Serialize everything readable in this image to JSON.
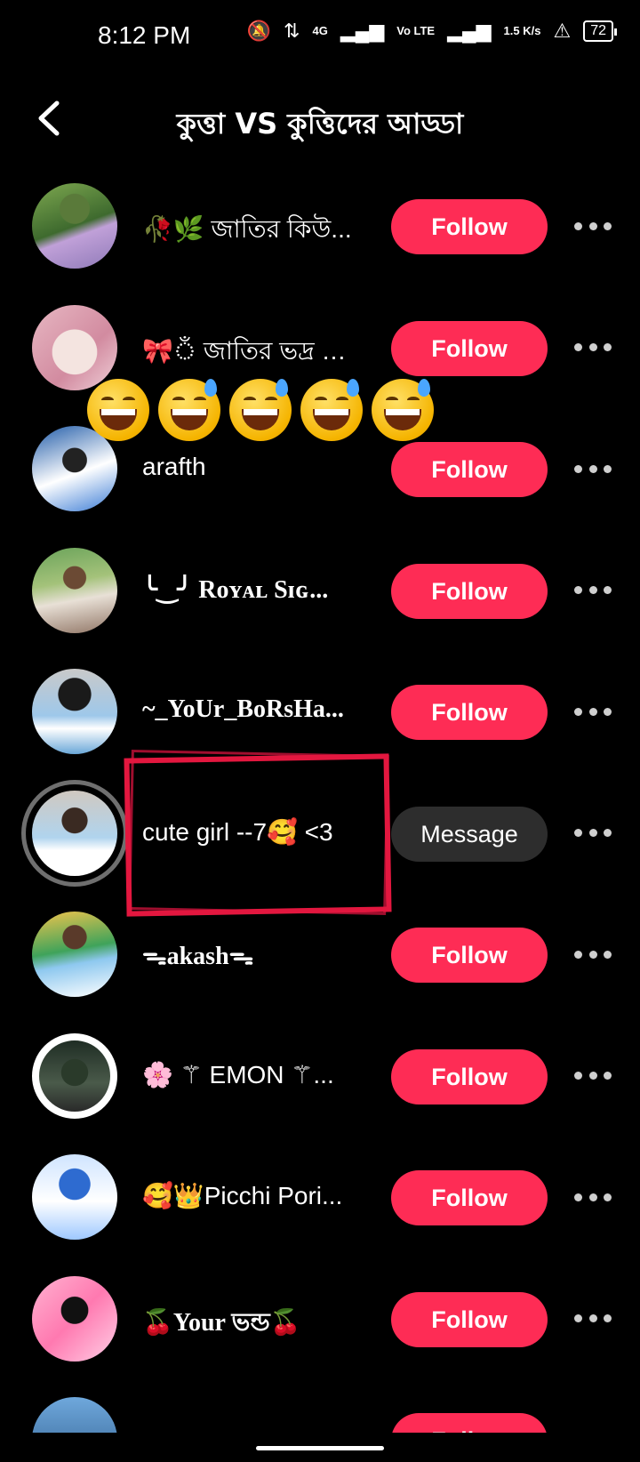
{
  "status_bar": {
    "time": "8:12 PM",
    "network_4g": "4G",
    "volte": "Vo LTE",
    "speed": "1.5 K/s",
    "battery": "72"
  },
  "header": {
    "title": "কুত্তা VS কুত্তিদের আড্ডা"
  },
  "overlay": {
    "emojis": [
      "😅",
      "😅",
      "😅",
      "😅",
      "😅"
    ]
  },
  "rows": [
    {
      "name": "🥀🌿 জাতির কিউ...",
      "action": "Follow"
    },
    {
      "name": "🎀ঁ জাতির ভদ্র ভা...",
      "action": "Follow"
    },
    {
      "name": "arafth",
      "action": "Follow"
    },
    {
      "name": "╰‿╯ Rᴏʏᴀʟ  Sɪɢ...",
      "action": "Follow"
    },
    {
      "name": "~_YoUr_BoRsHa...",
      "action": "Follow"
    },
    {
      "name": "cute girl --7🥰 <3",
      "action": "Message"
    },
    {
      "name": "ᯓakashᯓ",
      "action": "Follow"
    },
    {
      "name": "🌸 ⚚ EMON ⚚...",
      "action": "Follow"
    },
    {
      "name": "🥰👑Picchi Pori...",
      "action": "Follow"
    },
    {
      "name": "🍒Your ভন্ড🍒",
      "action": "Follow"
    },
    {
      "name": "",
      "action": "Follow"
    }
  ],
  "colors": {
    "follow": "#fe2c55",
    "message": "#2d2d2d",
    "highlight": "#e3173f"
  }
}
